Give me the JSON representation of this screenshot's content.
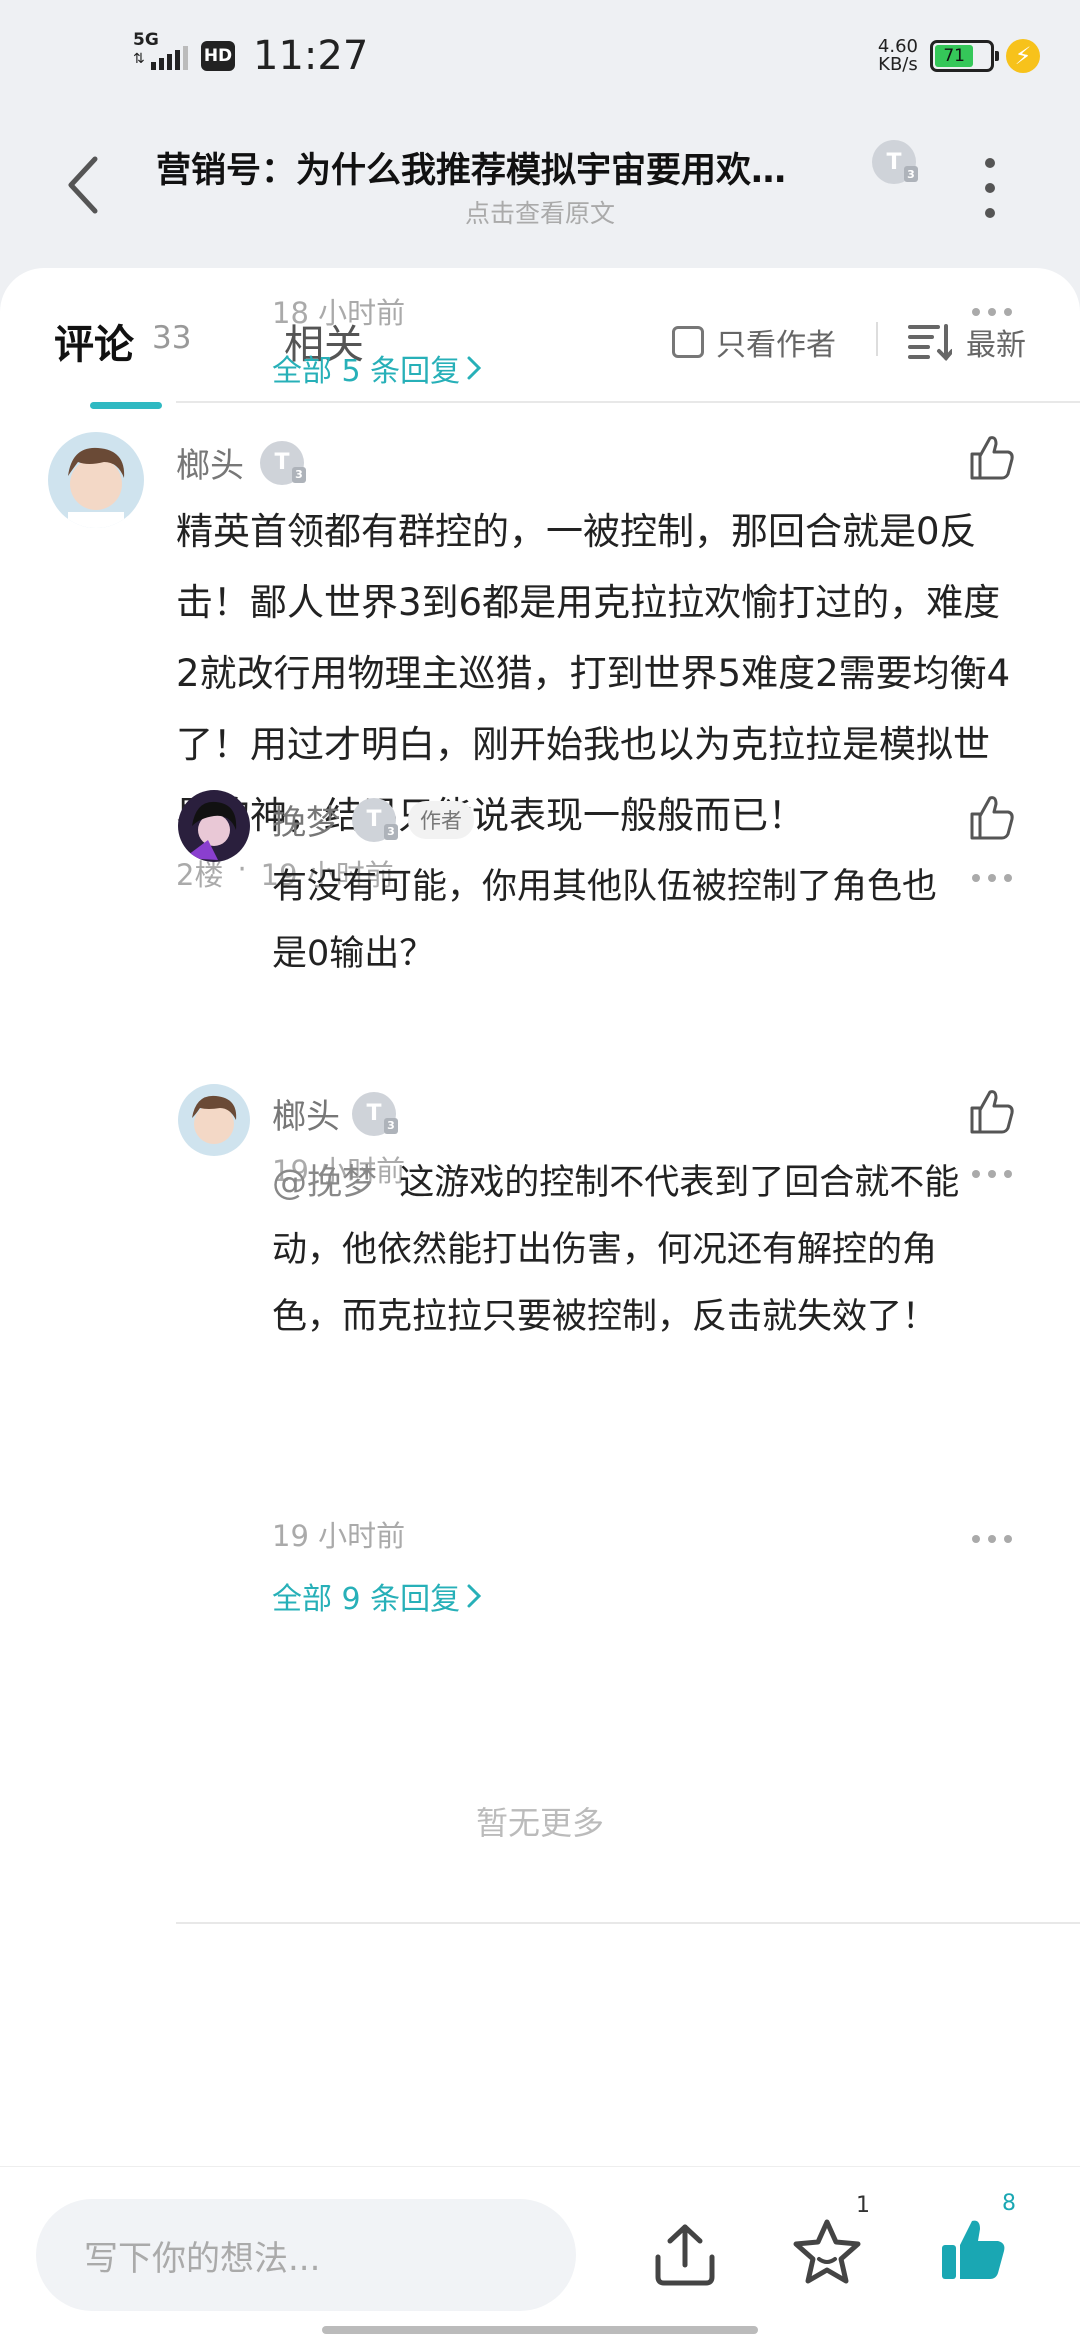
{
  "status": {
    "network": "5G",
    "hd": "HD",
    "time": "11:27",
    "speed_value": "4.60",
    "speed_unit": "KB/s",
    "battery": "71",
    "battery_level": 0.71
  },
  "header": {
    "title": "营销号：为什么我推荐模拟宇宙要用欢…",
    "subtitle": "点击查看原文",
    "badge": "T",
    "badge_level": "3"
  },
  "tabs": {
    "comments_label": "评论",
    "comments_count": "33",
    "related_label": "相关",
    "author_only_label": "只看作者",
    "sort_label": "最新"
  },
  "prev_thread": {
    "time": "18 小时前",
    "replies_link": "全部 5 条回复"
  },
  "comment": {
    "user": "榔头",
    "badge": "T",
    "badge_level": "3",
    "lines": [
      "精英首领都有群控的，一被控制，那回合就是0反",
      "击！鄙人世界3到6都是用克拉拉欢愉打过的，难度",
      "2就改行用物理主巡猎，打到世界5难度2需要均衡4",
      "了！用过才明白，刚开始我也以为克拉拉是模拟世",
      "界的神，结果只能说表现一般般而已！"
    ],
    "floor": "2楼",
    "sep": "·",
    "time": "19 小时前",
    "replies_link": "全部 9 条回复"
  },
  "replies": [
    {
      "user": "挽梦",
      "badge": "T",
      "badge_level": "3",
      "tag": "作者",
      "lines": [
        "有没有可能，你用其他队伍被控制了角色也",
        "是0输出？"
      ],
      "time": "19 小时前"
    },
    {
      "user": "榔头",
      "badge": "T",
      "badge_level": "3",
      "mention": "@挽梦",
      "lines": [
        "这游戏的控制不代表到了回合就不能",
        "动，他依然能打出伤害，何况还有解控的角",
        "色，而克拉拉只要被控制，反击就失效了！"
      ],
      "time": "19 小时前"
    }
  ],
  "footer": {
    "no_more": "暂无更多",
    "input_placeholder": "写下你的想法...",
    "star_count": "1",
    "like_count": "8"
  },
  "colors": {
    "accent": "#27b0b8",
    "like_active": "#1aa7b3"
  }
}
